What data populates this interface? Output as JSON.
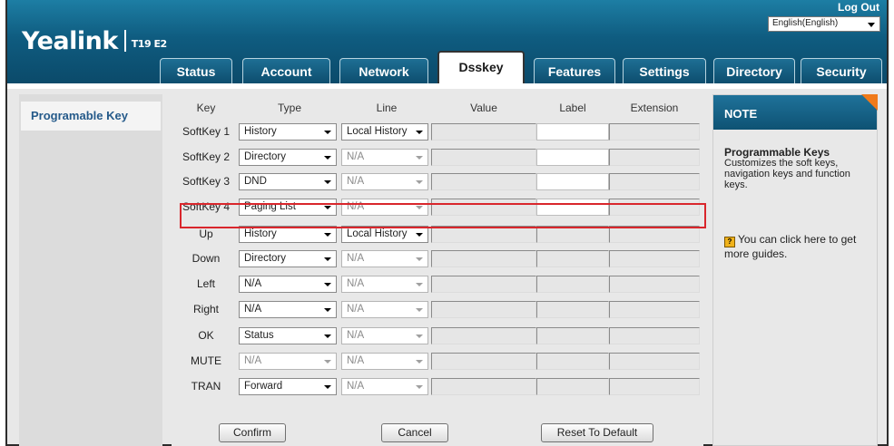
{
  "header": {
    "brand": "Yealink",
    "model": "T19 E2",
    "logout": "Log Out",
    "language": "English(English)"
  },
  "tabs": [
    {
      "label": "Status",
      "active": false
    },
    {
      "label": "Account",
      "active": false
    },
    {
      "label": "Network",
      "active": false
    },
    {
      "label": "Dsskey",
      "active": true
    },
    {
      "label": "Features",
      "active": false
    },
    {
      "label": "Settings",
      "active": false
    },
    {
      "label": "Directory",
      "active": false
    },
    {
      "label": "Security",
      "active": false
    }
  ],
  "sidebar": {
    "items": [
      {
        "label": "Programable Key"
      }
    ]
  },
  "table": {
    "headers": [
      "Key",
      "Type",
      "Line",
      "Value",
      "Label",
      "Extension"
    ],
    "rows": [
      {
        "key": "SoftKey 1",
        "type": "History",
        "type_enabled": true,
        "line": "Local History",
        "line_enabled": true,
        "label_white": true
      },
      {
        "key": "SoftKey 2",
        "type": "Directory",
        "type_enabled": true,
        "line": "N/A",
        "line_enabled": false,
        "label_white": true
      },
      {
        "key": "SoftKey 3",
        "type": "DND",
        "type_enabled": true,
        "line": "N/A",
        "line_enabled": false,
        "label_white": true
      },
      {
        "key": "SoftKey 4",
        "type": "Paging List",
        "type_enabled": true,
        "line": "N/A",
        "line_enabled": false,
        "label_white": true
      },
      {
        "key": "Up",
        "type": "History",
        "type_enabled": true,
        "line": "Local History",
        "line_enabled": true,
        "label_white": false
      },
      {
        "key": "Down",
        "type": "Directory",
        "type_enabled": true,
        "line": "N/A",
        "line_enabled": false,
        "label_white": false
      },
      {
        "key": "Left",
        "type": "N/A",
        "type_enabled": true,
        "line": "N/A",
        "line_enabled": false,
        "label_white": false
      },
      {
        "key": "Right",
        "type": "N/A",
        "type_enabled": true,
        "line": "N/A",
        "line_enabled": false,
        "label_white": false
      },
      {
        "key": "OK",
        "type": "Status",
        "type_enabled": true,
        "line": "N/A",
        "line_enabled": false,
        "label_white": false
      },
      {
        "key": "MUTE",
        "type": "N/A",
        "type_enabled": false,
        "line": "N/A",
        "line_enabled": false,
        "label_white": false
      },
      {
        "key": "TRAN",
        "type": "Forward",
        "type_enabled": true,
        "line": "N/A",
        "line_enabled": false,
        "label_white": false
      }
    ]
  },
  "buttons": {
    "confirm": "Confirm",
    "cancel": "Cancel",
    "reset": "Reset To Default"
  },
  "note": {
    "header": "NOTE",
    "title": "Programmable Keys",
    "text": "Customizes the soft keys, navigation keys and function keys.",
    "guide": "You can click here to get more guides.",
    "guide_icon": "?"
  },
  "colors": {
    "header": "#0f5c80",
    "highlight": "#d9262c",
    "note_corner": "#f07a1a",
    "sidebar_text": "#255a8a"
  }
}
